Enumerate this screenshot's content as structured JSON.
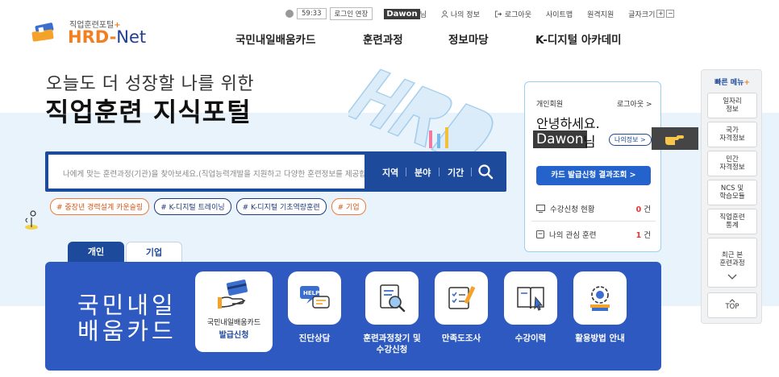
{
  "util": {
    "timer": "59:33",
    "extend": "로그인 연장",
    "username": "Dawon",
    "username_suffix": "님",
    "my_info": "나의 정보",
    "logout": "로그아웃",
    "sitemap": "사이트맵",
    "remote": "원격지원",
    "font_size": "글자크기",
    "plus": "+",
    "minus": "−"
  },
  "logo": {
    "sub": "직업훈련포털",
    "sub_mark": "+",
    "main_a": "HRD",
    "main_sep": "-",
    "main_b": "Net"
  },
  "gnb": [
    "국민내일배움카드",
    "훈련과정",
    "정보마당",
    "K-디지털 아카데미"
  ],
  "hero": {
    "line1": "오늘도 더 성장할 나를 위한",
    "line2": "직업훈련 지식포털"
  },
  "search": {
    "placeholder": "나에게 맞는 훈련과정(기관)을 찾아보세요.(직업능력개발을 지원하고 다양한 훈련정보를 제공합니다.)",
    "options": [
      "지역",
      "분야",
      "기간"
    ]
  },
  "tags": [
    "# 중장년 경력설계 카운슬링",
    "# K-디지털 트레이닝",
    "# K-디지털 기초역량훈련",
    "# 기업"
  ],
  "panel": {
    "member_type": "개인회원",
    "logout": "로그아웃 >",
    "hello": "안녕하세요.",
    "name": "Dawon",
    "nim": "님",
    "my_info": "나의정보 >",
    "card_button": "카드 발급신청 결과조회  >",
    "rows": [
      {
        "label": "수강신청 현황",
        "count": "0",
        "unit": "건"
      },
      {
        "label": "나의 관심 훈련",
        "count": "1",
        "unit": "건"
      }
    ]
  },
  "quick": {
    "title": "빠른 메뉴",
    "title_mark": "+",
    "items": [
      "일자리\n정보",
      "국가\n자격정보",
      "민간\n자격정보",
      "NCS 및\n학습모듈",
      "직업훈련\n통계",
      "최근 본\n훈련과정"
    ],
    "top": "TOP"
  },
  "tabs": [
    "개인",
    "기업"
  ],
  "section": {
    "title": "국민내일\n배움카드",
    "big_label": "국민내일배움카드",
    "big_label2": "발급신청",
    "services": [
      "진단상담",
      "훈련과정찾기 및\n수강신청",
      "만족도조사",
      "수강이력",
      "활용방법 안내"
    ]
  },
  "colors": {
    "primary": "#1e4a9b",
    "accent": "#f08020",
    "section": "#2d59c0",
    "band": "#e9f3fb"
  }
}
